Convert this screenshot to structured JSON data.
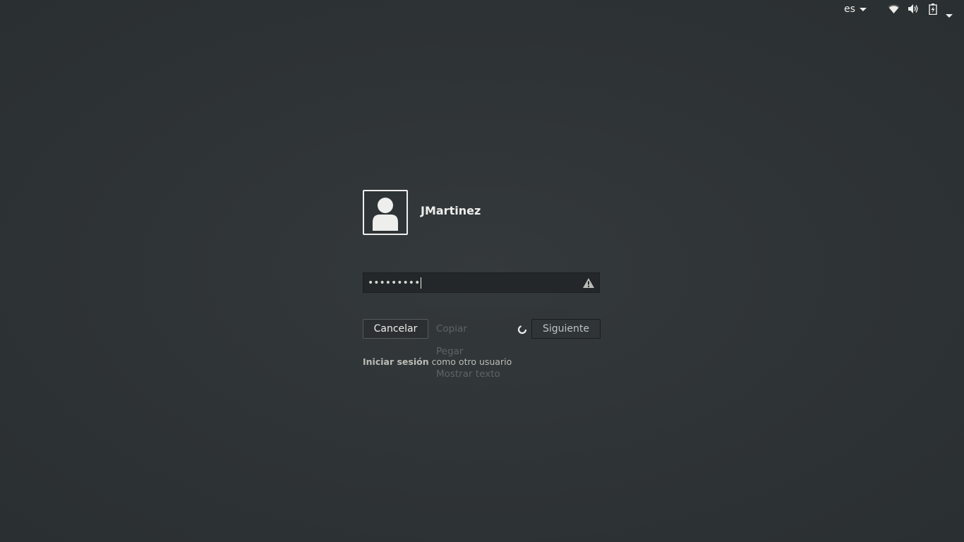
{
  "topbar": {
    "language": "es",
    "icons": [
      "wifi-icon",
      "volume-icon",
      "battery-icon",
      "system-menu-caret-icon"
    ]
  },
  "user": {
    "name": "JMartinez",
    "avatar_icon": "user-avatar-icon"
  },
  "password": {
    "masked_value": "•••••••••",
    "warning_icon": "caps-lock-warning-icon"
  },
  "buttons": {
    "cancel_label": "Cancelar",
    "next_label": "Siguiente"
  },
  "other_user": {
    "label_bold": "Iniciar sesión",
    "label_rest": " como otro usuario"
  },
  "context_menu": {
    "items": [
      "Copiar",
      "Pegar",
      "Mostrar texto"
    ]
  },
  "colors": {
    "background": "#2e3436",
    "foreground": "#eeeeec",
    "entry_bg": "#232729"
  }
}
